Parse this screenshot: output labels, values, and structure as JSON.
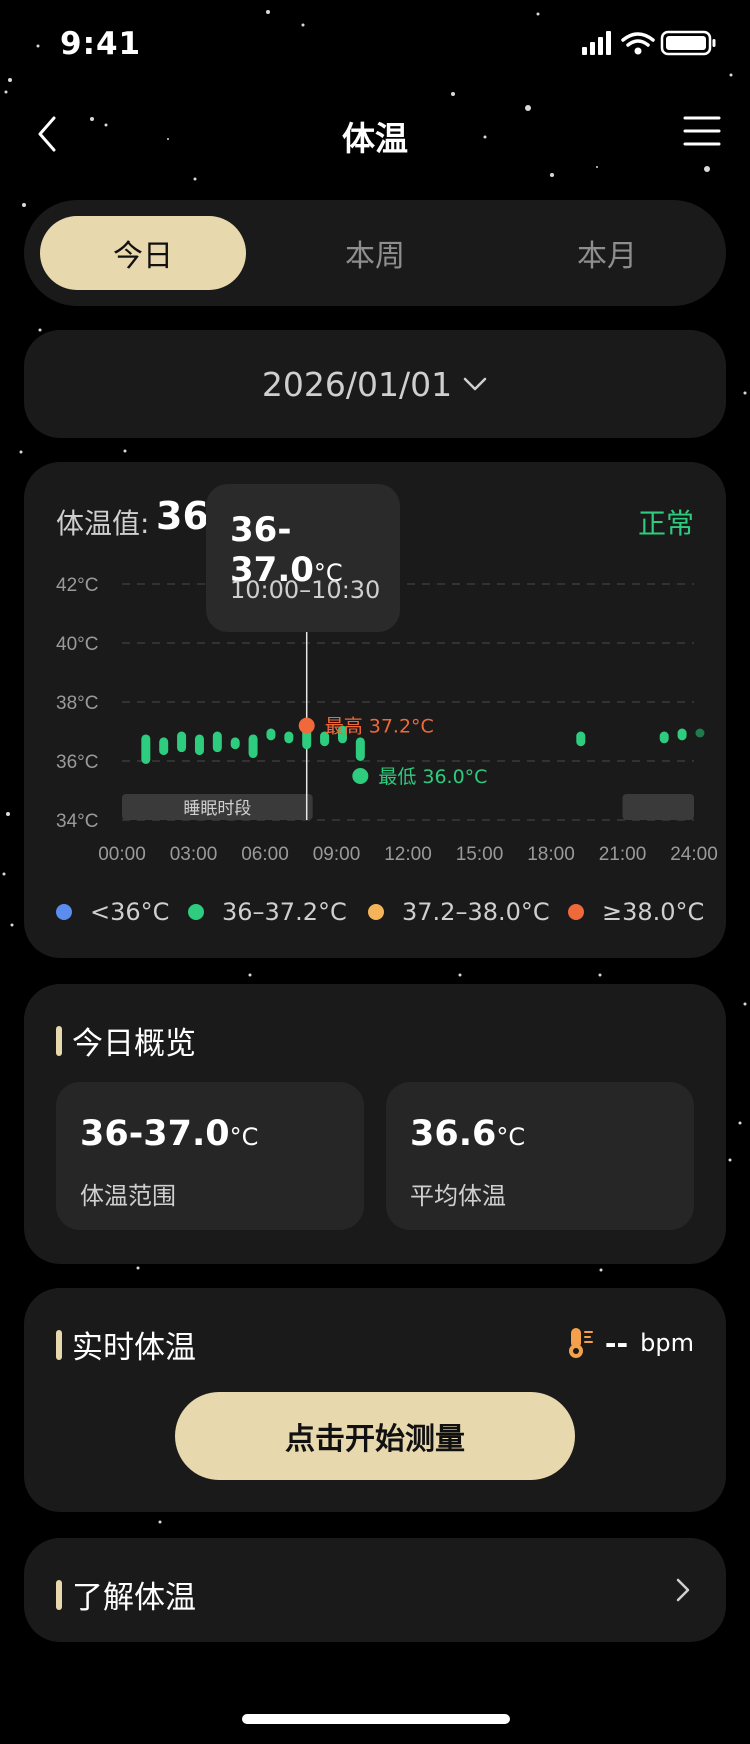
{
  "status_bar": {
    "time": "9:41"
  },
  "nav": {
    "title": "体温"
  },
  "tabs": [
    {
      "label": "今日",
      "active": true
    },
    {
      "label": "本周",
      "active": false
    },
    {
      "label": "本月",
      "active": false
    }
  ],
  "date_selector": {
    "value": "2026/01/01"
  },
  "chart_card": {
    "label": "体温值:",
    "value": "36.",
    "status": "正常",
    "tooltip": {
      "value": "36-37.0",
      "unit": "°C",
      "time": "10:00–10:30"
    },
    "sleep_label": "睡眠时段",
    "max_label": "最高  37.2°C",
    "min_label": "最低  36.0°C",
    "legend": [
      {
        "label": "<36°C",
        "color": "#5b8def"
      },
      {
        "label": "36–37.2°C",
        "color": "#2ecc7e"
      },
      {
        "label": "37.2–38.0°C",
        "color": "#f5b35a"
      },
      {
        "label": "≥38.0°C",
        "color": "#f0693a"
      }
    ]
  },
  "chart_data": {
    "type": "bar",
    "y_ticks": [
      "42°C",
      "40°C",
      "38°C",
      "36°C",
      "34°C"
    ],
    "x_ticks": [
      "00:00",
      "03:00",
      "06:00",
      "09:00",
      "12:00",
      "15:00",
      "18:00",
      "21:00",
      "24:00"
    ],
    "ylim": [
      34,
      42
    ],
    "xlim": [
      0,
      24
    ],
    "series": [
      {
        "ranges": [
          {
            "t": 1.0,
            "low": 35.9,
            "high": 36.9
          },
          {
            "t": 1.75,
            "low": 36.2,
            "high": 36.8
          },
          {
            "t": 2.5,
            "low": 36.3,
            "high": 37.0
          },
          {
            "t": 3.25,
            "low": 36.2,
            "high": 36.9
          },
          {
            "t": 4.0,
            "low": 36.3,
            "high": 37.0
          },
          {
            "t": 4.75,
            "low": 36.4,
            "high": 36.8
          },
          {
            "t": 5.5,
            "low": 36.1,
            "high": 36.9
          },
          {
            "t": 6.25,
            "low": 36.7,
            "high": 37.1
          },
          {
            "t": 7.0,
            "low": 36.6,
            "high": 37.0
          },
          {
            "t": 7.75,
            "low": 36.4,
            "high": 37.2
          },
          {
            "t": 8.5,
            "low": 36.5,
            "high": 37.0
          },
          {
            "t": 9.25,
            "low": 36.6,
            "high": 37.2
          },
          {
            "t": 10.0,
            "low": 36.0,
            "high": 36.8
          },
          {
            "t": 19.25,
            "low": 36.5,
            "high": 37.0
          },
          {
            "t": 22.75,
            "low": 36.6,
            "high": 37.0
          },
          {
            "t": 23.5,
            "low": 36.7,
            "high": 37.1
          },
          {
            "t": 24.25,
            "low": 36.8,
            "high": 37.1
          }
        ]
      }
    ],
    "max": {
      "t": 7.75,
      "value": 37.2
    },
    "min": {
      "t": 10.0,
      "value": 36.0
    },
    "sleep_periods": [
      [
        0,
        8
      ],
      [
        21,
        24
      ]
    ],
    "selected_time": 7.75,
    "grid": true
  },
  "overview": {
    "title": "今日概览",
    "stats": [
      {
        "value": "36-37.0",
        "unit": "°C",
        "label": "体温范围"
      },
      {
        "value": "36.6",
        "unit": "°C",
        "label": "平均体温"
      }
    ]
  },
  "realtime": {
    "title": "实时体温",
    "value": "--",
    "unit": "bpm",
    "button": "点击开始测量",
    "icon": "thermometer-icon"
  },
  "learn": {
    "title": "了解体温"
  },
  "colors": {
    "accent": "#e8d8ad",
    "normal": "#2ecc7e",
    "high": "#f0693a"
  }
}
